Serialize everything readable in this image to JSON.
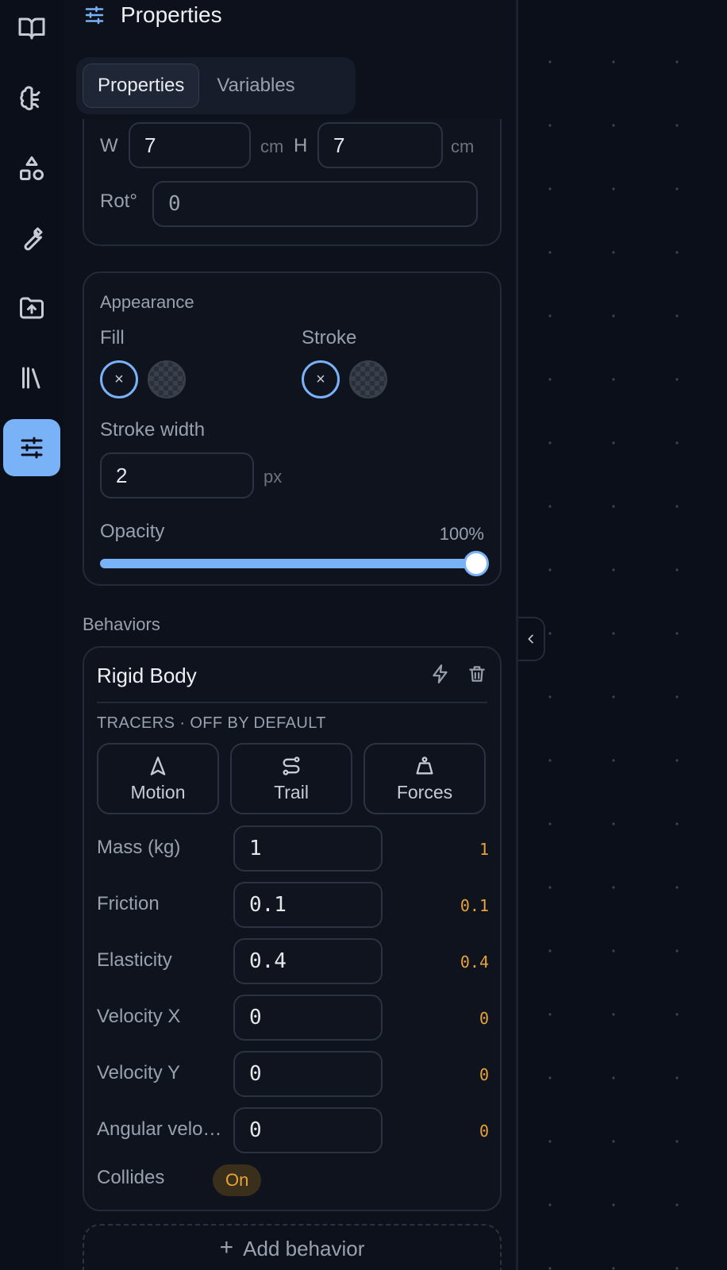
{
  "rail": {
    "items": [
      "book-icon",
      "brain-icon",
      "shapes-icon",
      "wrench-icon",
      "folder-upload-icon",
      "library-icon",
      "sliders-icon"
    ],
    "active": "sliders-icon"
  },
  "panel": {
    "title": "Properties"
  },
  "tabs": [
    {
      "label": "Properties",
      "active": true
    },
    {
      "label": "Variables",
      "active": false
    }
  ],
  "transform": {
    "w_label": "W",
    "w_value": "7",
    "w_unit": "cm",
    "h_label": "H",
    "h_value": "7",
    "h_unit": "cm",
    "rot_label": "Rot°",
    "rot_value": "0"
  },
  "appearance": {
    "title": "Appearance",
    "fill_label": "Fill",
    "stroke_label": "Stroke",
    "none_glyph": "×",
    "stroke_width_label": "Stroke width",
    "stroke_width_value": "2",
    "stroke_width_unit": "px",
    "opacity_label": "Opacity",
    "opacity_text": "100%",
    "opacity_value": 1.0
  },
  "behaviors": {
    "section_label": "Behaviors",
    "rigid_body": {
      "title": "Rigid Body",
      "tracers_label": "TRACERS · OFF BY DEFAULT",
      "tracers": [
        {
          "label": "Motion",
          "icon": "navigation-arrow-icon"
        },
        {
          "label": "Trail",
          "icon": "route-icon"
        },
        {
          "label": "Forces",
          "icon": "weight-icon"
        }
      ],
      "props": [
        {
          "label": "Mass (kg)",
          "input": "1",
          "value": "1"
        },
        {
          "label": "Friction",
          "input": "0.1",
          "value": "0.1"
        },
        {
          "label": "Elasticity",
          "input": "0.4",
          "value": "0.4"
        },
        {
          "label": "Velocity X",
          "input": "0",
          "value": "0"
        },
        {
          "label": "Velocity Y",
          "input": "0",
          "value": "0"
        },
        {
          "label": "Angular velocity",
          "input": "0",
          "value": "0"
        }
      ],
      "collides_label": "Collides",
      "collides_value": "On"
    },
    "add_label": "Add behavior"
  },
  "colors": {
    "accent": "#7ab2f8",
    "value": "#e8a23a",
    "background": "#0b0f19"
  }
}
